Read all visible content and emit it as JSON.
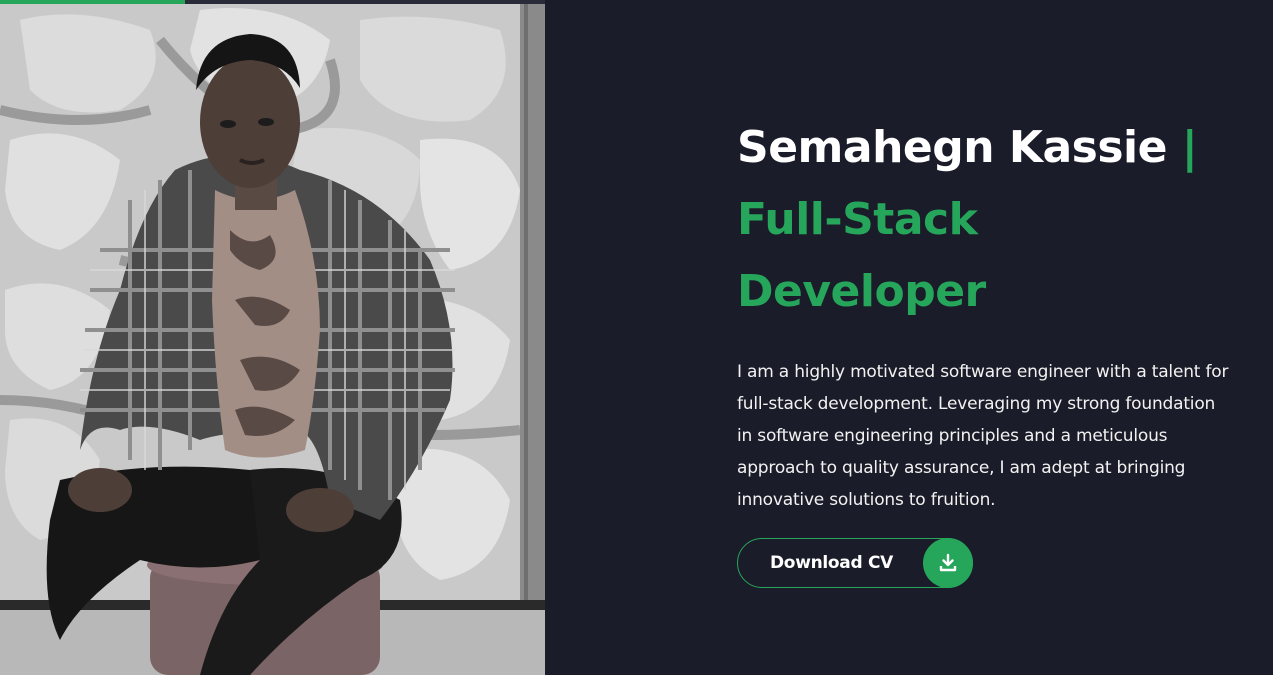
{
  "header": {
    "progress": 0.34,
    "progress_color": "#26a65b"
  },
  "hero": {
    "photo_icon": "portrait-photo",
    "name": "Semahegn Kassie",
    "separator": "|",
    "role_line1": "Full-Stack",
    "role_line2": "Developer",
    "bio": "I am a highly motivated software engineer with a talent for full-stack development. Leveraging my strong foundation in software engineering principles and a meticulous approach to quality assurance, I am adept at bringing innovative solutions to fruition.",
    "cv_button_label": "Download CV",
    "cv_button_icon": "download-icon"
  },
  "colors": {
    "background": "#1b1c29",
    "accent": "#26a65b",
    "text": "#ffffff"
  }
}
